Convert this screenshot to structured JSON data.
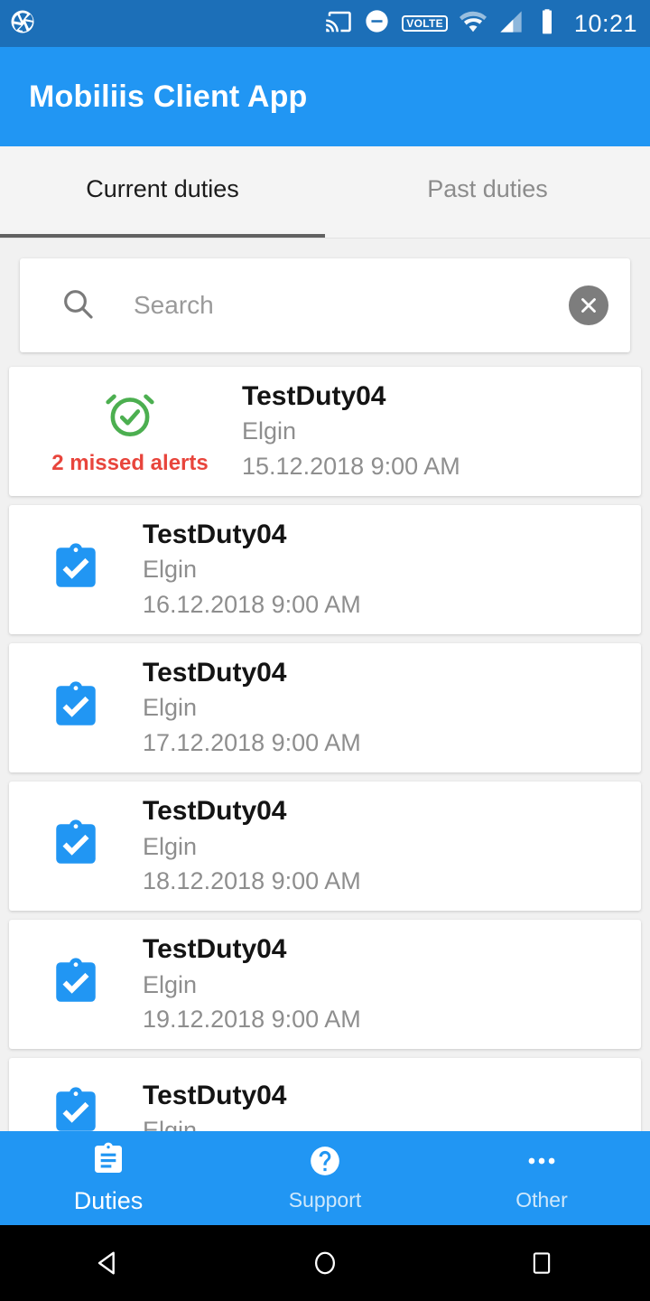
{
  "status_bar": {
    "app_icon": "camera-aperture-icon",
    "icons": [
      "cast-icon",
      "do-not-disturb-icon",
      "volte-badge",
      "wifi-icon",
      "cellular-signal-icon",
      "battery-icon"
    ],
    "volte_label": "VOLTE",
    "time": "10:21",
    "background_color": "#1c6fb8"
  },
  "app_bar": {
    "title": "Mobiliis Client App",
    "background_color": "#2196f3"
  },
  "tabs": [
    {
      "label": "Current duties",
      "active": true
    },
    {
      "label": "Past duties",
      "active": false
    }
  ],
  "search": {
    "placeholder": "Search",
    "value": "",
    "search_icon": "search-icon",
    "clear_icon": "clear-circle-icon"
  },
  "duties": [
    {
      "icon": "alarm-check-icon",
      "icon_color": "#4caf50",
      "alert_text": "2 missed alerts",
      "alert_color": "#e8453c",
      "title": "TestDuty04",
      "location": "Elgin",
      "datetime": "15.12.2018 9:00 AM"
    },
    {
      "icon": "assignment-turned-in-icon",
      "icon_color": "#2196f3",
      "alert_text": "",
      "title": "TestDuty04",
      "location": "Elgin",
      "datetime": "16.12.2018 9:00 AM"
    },
    {
      "icon": "assignment-turned-in-icon",
      "icon_color": "#2196f3",
      "alert_text": "",
      "title": "TestDuty04",
      "location": "Elgin",
      "datetime": "17.12.2018 9:00 AM"
    },
    {
      "icon": "assignment-turned-in-icon",
      "icon_color": "#2196f3",
      "alert_text": "",
      "title": "TestDuty04",
      "location": "Elgin",
      "datetime": "18.12.2018 9:00 AM"
    },
    {
      "icon": "assignment-turned-in-icon",
      "icon_color": "#2196f3",
      "alert_text": "",
      "title": "TestDuty04",
      "location": "Elgin",
      "datetime": "19.12.2018 9:00 AM"
    },
    {
      "icon": "assignment-turned-in-icon",
      "icon_color": "#2196f3",
      "alert_text": "",
      "title": "TestDuty04",
      "location": "Elgin",
      "datetime": ""
    }
  ],
  "bottom_nav": [
    {
      "label": "Duties",
      "icon": "clipboard-icon",
      "active": true
    },
    {
      "label": "Support",
      "icon": "help-circle-icon",
      "active": false
    },
    {
      "label": "Other",
      "icon": "more-horizontal-icon",
      "active": false
    }
  ],
  "android_nav": [
    "back-icon",
    "home-icon",
    "recents-icon"
  ]
}
